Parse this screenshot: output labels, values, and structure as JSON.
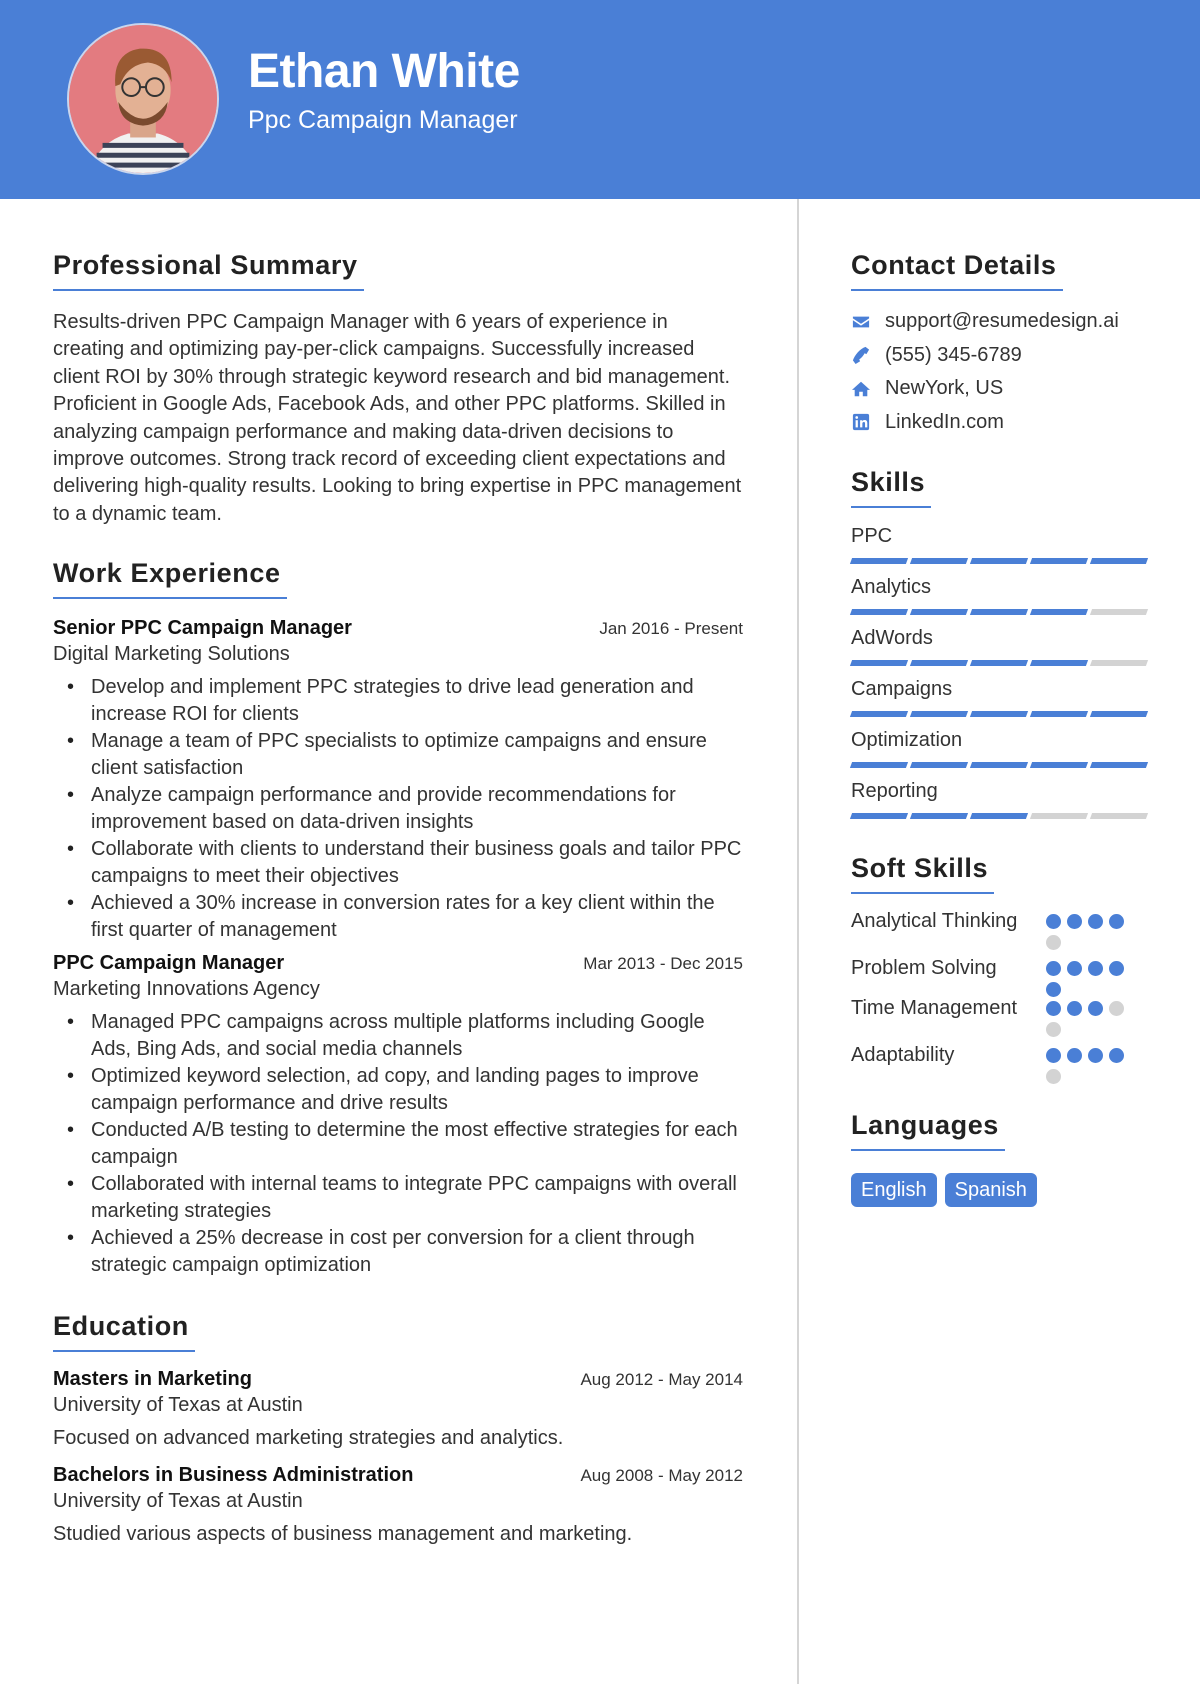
{
  "header": {
    "name": "Ethan White",
    "role": "Ppc Campaign Manager",
    "avatar": "profile-photo"
  },
  "colors": {
    "accent": "#4a7fd6",
    "inactive": "#d3d3d3",
    "avatar_background": "#e37b80"
  },
  "summary": {
    "title": "Professional Summary",
    "text": "Results-driven PPC Campaign Manager with 6 years of experience in creating and optimizing pay-per-click campaigns. Successfully increased client ROI by 30% through strategic keyword research and bid management. Proficient in Google Ads, Facebook Ads, and other PPC platforms. Skilled in analyzing campaign performance and making data-driven decisions to improve outcomes. Strong track record of exceeding client expectations and delivering high-quality results. Looking to bring expertise in PPC management to a dynamic team."
  },
  "experience": {
    "title": "Work Experience",
    "jobs": [
      {
        "title": "Senior PPC Campaign Manager",
        "date": "Jan 2016 - Present",
        "company": "Digital Marketing Solutions",
        "bullets": [
          "Develop and implement PPC strategies to drive lead generation and increase ROI for clients",
          "Manage a team of PPC specialists to optimize campaigns and ensure client satisfaction",
          "Analyze campaign performance and provide recommendations for improvement based on data-driven insights",
          "Collaborate with clients to understand their business goals and tailor PPC campaigns to meet their objectives",
          "Achieved a 30% increase in conversion rates for a key client within the first quarter of management"
        ]
      },
      {
        "title": "PPC Campaign Manager",
        "date": "Mar 2013 - Dec 2015",
        "company": "Marketing Innovations Agency",
        "bullets": [
          "Managed PPC campaigns across multiple platforms including Google Ads, Bing Ads, and social media channels",
          "Optimized keyword selection, ad copy, and landing pages to improve campaign performance and drive results",
          "Conducted A/B testing to determine the most effective strategies for each campaign",
          "Collaborated with internal teams to integrate PPC campaigns with overall marketing strategies",
          "Achieved a 25% decrease in cost per conversion for a client through strategic campaign optimization"
        ]
      }
    ]
  },
  "education": {
    "title": "Education",
    "items": [
      {
        "degree": "Masters in Marketing",
        "date": "Aug 2012 - May 2014",
        "school": "University of Texas at Austin",
        "desc": "Focused on advanced marketing strategies and analytics."
      },
      {
        "degree": "Bachelors in Business Administration",
        "date": "Aug 2008 - May 2012",
        "school": "University of Texas at Austin",
        "desc": "Studied various aspects of business management and marketing."
      }
    ]
  },
  "contact": {
    "title": "Contact Details",
    "items": [
      {
        "icon": "envelope-icon",
        "text": "support@resumedesign.ai"
      },
      {
        "icon": "phone-icon",
        "text": "(555) 345-6789"
      },
      {
        "icon": "home-icon",
        "text": "NewYork, US"
      },
      {
        "icon": "linkedin-icon",
        "text": "LinkedIn.com"
      }
    ]
  },
  "skills": {
    "title": "Skills",
    "max": 5,
    "items": [
      {
        "name": "PPC",
        "level": 5
      },
      {
        "name": "Analytics",
        "level": 4
      },
      {
        "name": "AdWords",
        "level": 4
      },
      {
        "name": "Campaigns",
        "level": 5
      },
      {
        "name": "Optimization",
        "level": 5
      },
      {
        "name": "Reporting",
        "level": 3
      }
    ]
  },
  "soft_skills": {
    "title": "Soft Skills",
    "max": 5,
    "items": [
      {
        "name": "Analytical Thinking",
        "level": 4
      },
      {
        "name": "Problem Solving",
        "level": 5
      },
      {
        "name": "Time Management",
        "level": 3
      },
      {
        "name": "Adaptability",
        "level": 4
      }
    ]
  },
  "languages": {
    "title": "Languages",
    "items": [
      "English",
      "Spanish"
    ]
  }
}
